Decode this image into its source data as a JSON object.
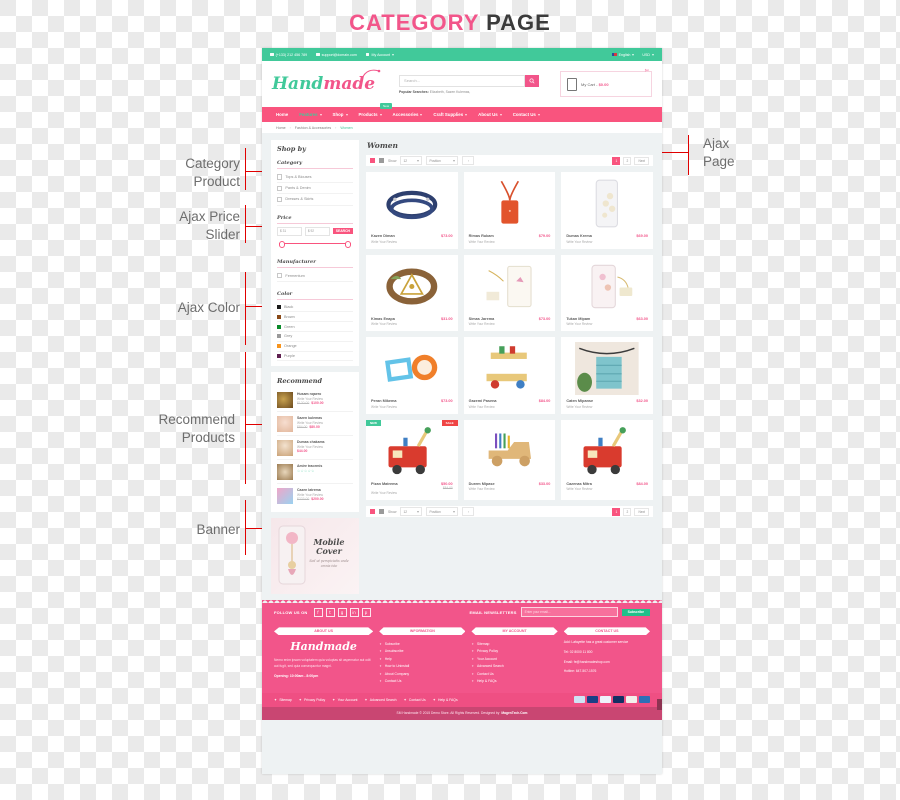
{
  "page_title": {
    "accent": "CATEGORY",
    "rest": "PAGE"
  },
  "annotations": {
    "left": [
      {
        "label": "Category\nProduct"
      },
      {
        "label": "Ajax Price\nSlider"
      },
      {
        "label": "Ajax Color"
      },
      {
        "label": "Recommend\nProducts"
      },
      {
        "label": "Banner"
      }
    ],
    "right": [
      {
        "label": "Ajax\nPage"
      }
    ]
  },
  "colors": {
    "pink": "#f2558a",
    "nav_pink": "#f9547e",
    "green": "#41c99a",
    "red_anno": "#e00000"
  },
  "topbar": {
    "phone": "(+133) 212 456 789",
    "email": "support@domain.com",
    "account": "My Account",
    "language": "English",
    "currency": "USD"
  },
  "header": {
    "logo_a": "Hand",
    "logo_b": "made",
    "search_placeholder": "Search...",
    "popular_label": "Popular Searches:",
    "popular_terms": "Elizabeth, Sazen Kulemas,",
    "cart_label": "My Cart -",
    "cart_amount": "$0.00"
  },
  "nav": {
    "new_tag": "New",
    "items": [
      {
        "label": "Home",
        "active": false,
        "caret": false
      },
      {
        "label": "Features",
        "active": true,
        "caret": true
      },
      {
        "label": "Shop",
        "active": false,
        "caret": true
      },
      {
        "label": "Products",
        "active": false,
        "caret": true
      },
      {
        "label": "Accessories",
        "active": false,
        "caret": true
      },
      {
        "label": "Craft Supplies",
        "active": false,
        "caret": true
      },
      {
        "label": "About Us",
        "active": false,
        "caret": true
      },
      {
        "label": "Contact Us",
        "active": false,
        "caret": true
      }
    ]
  },
  "breadcrumb": {
    "items": [
      "Home",
      "Fashion & Accessories"
    ],
    "current": "Women"
  },
  "sidebar": {
    "shop_by": "Shop by",
    "category": {
      "title": "Category",
      "items": [
        "Tops & Blouses",
        "Pants & Denim",
        "Dresses & Skirts"
      ]
    },
    "price": {
      "title": "Price",
      "min_placeholder": "$ 31",
      "max_placeholder": "$ 92",
      "search_label": "SEARCH"
    },
    "manufacturer": {
      "title": "Manufacturer",
      "items": [
        "Fermentum"
      ]
    },
    "color": {
      "title": "Color",
      "items": [
        {
          "label": "Black",
          "hex": "#1a1a1a"
        },
        {
          "label": "Brown",
          "hex": "#8a4a18"
        },
        {
          "label": "Green",
          "hex": "#0a8a2a"
        },
        {
          "label": "Grey",
          "hex": "#9a9a9a"
        },
        {
          "label": "Orange",
          "hex": "#f7941d"
        },
        {
          "label": "Purple",
          "hex": "#5f2050"
        }
      ]
    },
    "recommend": {
      "title": "Recommend",
      "items": [
        {
          "name": "Husam nqaero",
          "review": "Write Your Review",
          "price": "$100.00",
          "old_price": "$120.00",
          "stars": ""
        },
        {
          "name": "Sazen kulemas",
          "review": "Write Your Review",
          "price": "$80.00",
          "old_price": "$84.00",
          "stars": ""
        },
        {
          "name": "Dumas chakams",
          "review": "Write Your Review",
          "price": "$44.00",
          "old_price": "",
          "stars": ""
        },
        {
          "name": "Amire tracemis",
          "review": "",
          "price": "",
          "old_price": "",
          "stars": "☆☆☆☆☆"
        },
        {
          "name": "Cazen latrema",
          "review": "Write Your Review",
          "price": "$200.00",
          "old_price": "$223.00",
          "stars": ""
        }
      ]
    },
    "banner": {
      "title": "Mobile\nCover",
      "subtitle": "Sed ut perspiciatis unde omnis iste"
    }
  },
  "main": {
    "title": "Women",
    "toolbar": {
      "show_label": "Show",
      "show_value": "12",
      "sort_value": "Position",
      "direction": "↑"
    },
    "pager": {
      "pages": [
        "1",
        "2"
      ],
      "current": "1",
      "next": "Next"
    },
    "review_label": "Write Your Review",
    "products": [
      {
        "name": "Kazen Diman",
        "price": "$73.00",
        "old_price": "",
        "badges": []
      },
      {
        "name": "Rimas Rukam",
        "price": "$79.00",
        "old_price": "",
        "badges": []
      },
      {
        "name": "Dumas Krema",
        "price": "$69.00",
        "old_price": "",
        "badges": []
      },
      {
        "name": "Kimas Enapa",
        "price": "$31.00",
        "old_price": "",
        "badges": []
      },
      {
        "name": "Simas Jarema",
        "price": "$73.00",
        "old_price": "",
        "badges": []
      },
      {
        "name": "Tukan Mipam",
        "price": "$63.00",
        "old_price": "",
        "badges": []
      },
      {
        "name": "Peran Mikema",
        "price": "$73.00",
        "old_price": "",
        "badges": []
      },
      {
        "name": "Gazemi Pasena",
        "price": "$84.00",
        "old_price": "",
        "badges": []
      },
      {
        "name": "Caten Mipanse",
        "price": "$32.00",
        "old_price": "",
        "badges": []
      },
      {
        "name": "Pizan Matrema",
        "price": "$50.00",
        "old_price": "$84.00",
        "badges": [
          "NEW",
          "SALE"
        ]
      },
      {
        "name": "Durem Mipase",
        "price": "$33.00",
        "old_price": "",
        "badges": []
      },
      {
        "name": "Cazenas Mitra",
        "price": "$84.00",
        "old_price": "",
        "badges": []
      }
    ]
  },
  "footer": {
    "follow_label": "FOLLOW US ON",
    "social": [
      "f",
      "t",
      "g",
      "in",
      "p"
    ],
    "newsletter_label": "EMAIL NEWSLETTERS",
    "newsletter_placeholder": "Enter your email...",
    "subscribe_label": "Subscribe",
    "brand": "Handmade",
    "about_head": "ABOUT US",
    "about_text": "Nemo enim ipsam voluptatem quia voluptas sit aspernatur aut odit aut fugit, sed quia consequuntur magni.",
    "opening": "Opening: 10:00am - 8:00pm",
    "information": {
      "head": "INFORMATION",
      "items": [
        "Subscribe",
        "Unsubscribe",
        "Help",
        "How to Uninstall",
        "About Company",
        "Contact Us"
      ]
    },
    "my_account": {
      "head": "MY ACCOUNT",
      "items": [
        "Sitemap",
        "Privacy Policy",
        "Your Account",
        "Advanced Search",
        "Contact Us",
        "Help & FAQs"
      ]
    },
    "contact": {
      "head": "CONTACT US",
      "lines": [
        "Add: Lafayette has a great customer service",
        "Tel: 02 8000 11 800",
        "Email: fe@handmadeshop.com",
        "Hotline: 647-507-1576"
      ]
    },
    "bottom_links": [
      "Sitemap",
      "Privacy Policy",
      "Your Account",
      "Advanced Search",
      "Contact Us",
      "Help & FAQs"
    ],
    "copyright": "SM Handmade © 2015 Demo Store. All Rights Reserved. Designed by",
    "copyright_brand": "MagenTech.Com",
    "gotop": "↑"
  }
}
